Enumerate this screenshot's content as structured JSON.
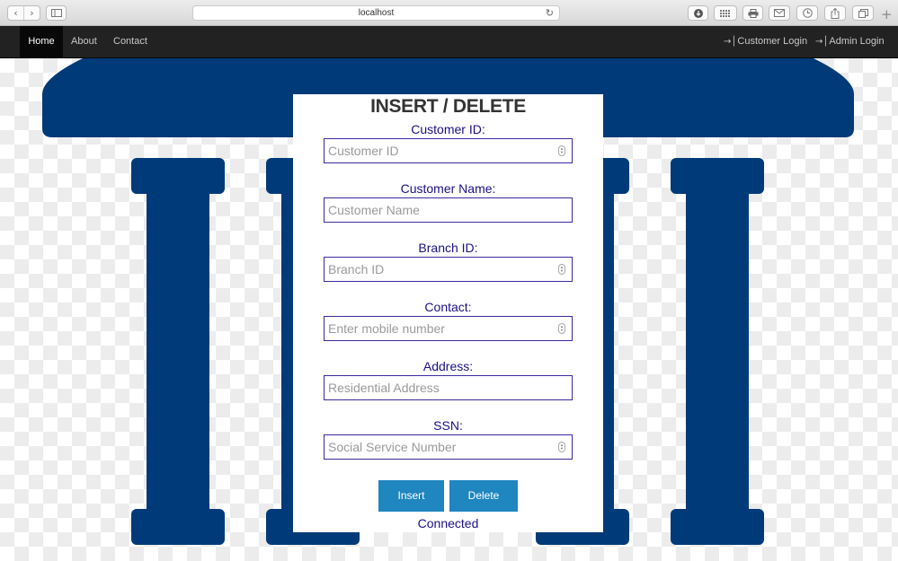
{
  "browser": {
    "url": "localhost",
    "new_tab_symbol": "+",
    "icons": [
      "back-icon",
      "forward-icon",
      "sidebar-icon",
      "reload-icon",
      "downloads-icon",
      "top-sites-icon",
      "print-icon",
      "mail-icon",
      "history-icon",
      "share-icon",
      "tabs-icon",
      "new-tab-icon"
    ]
  },
  "navbar": {
    "left": [
      {
        "label": "Home",
        "active": true
      },
      {
        "label": "About"
      },
      {
        "label": "Contact"
      }
    ],
    "right": [
      {
        "label": "Customer Login",
        "icon": "log-in-icon"
      },
      {
        "label": "Admin Login",
        "icon": "log-in-icon"
      }
    ]
  },
  "form": {
    "title": "INSERT / DELETE",
    "fields": [
      {
        "label": "Customer ID:",
        "placeholder": "Customer ID",
        "type": "number"
      },
      {
        "label": "Customer Name:",
        "placeholder": "Customer Name",
        "type": "text"
      },
      {
        "label": "Branch ID:",
        "placeholder": "Branch ID",
        "type": "number"
      },
      {
        "label": "Contact:",
        "placeholder": "Enter mobile number",
        "type": "number"
      },
      {
        "label": "Address:",
        "placeholder": "Residential Address",
        "type": "text"
      },
      {
        "label": "SSN:",
        "placeholder": "Social Service Number",
        "type": "number"
      }
    ],
    "insert_label": "Insert",
    "delete_label": "Delete",
    "status": "Connected"
  },
  "colors": {
    "navbar_bg": "#222222",
    "temple_blue": "#003a78",
    "label_color": "#1b0f86",
    "button_blue": "#1f86bf"
  }
}
